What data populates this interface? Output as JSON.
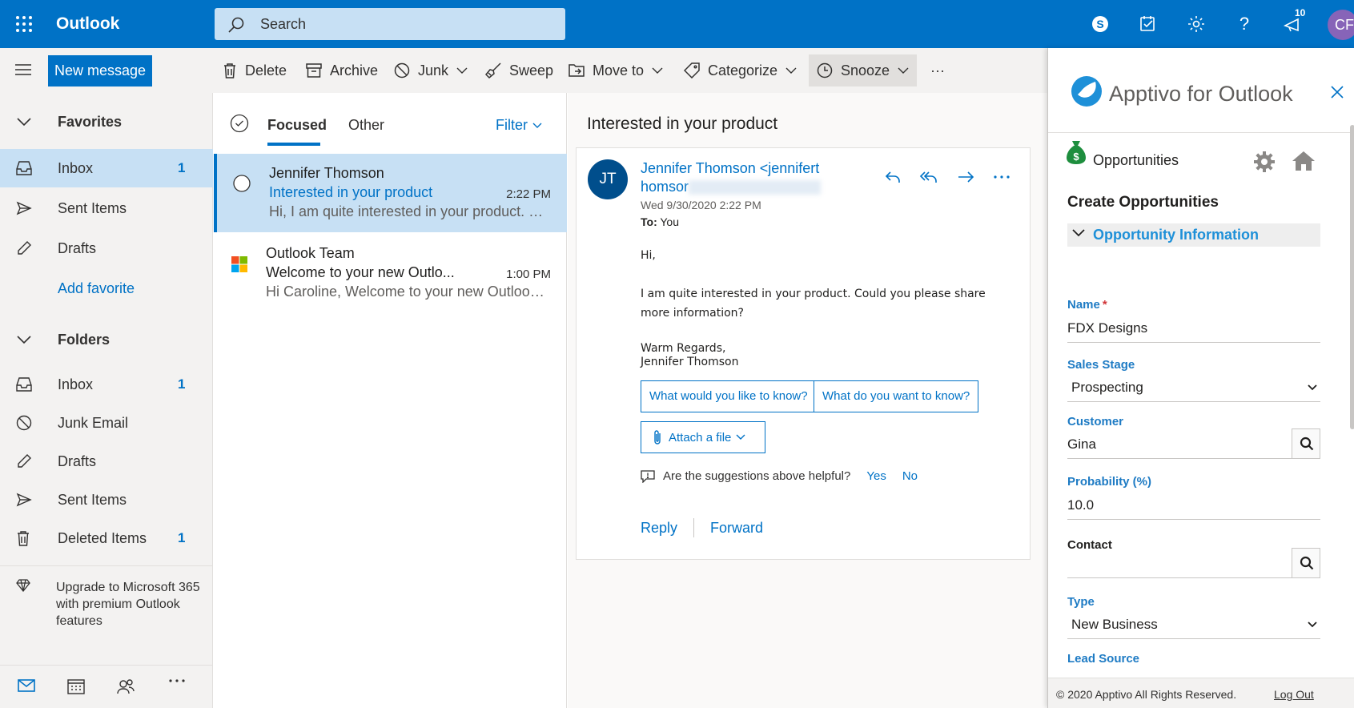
{
  "app": {
    "title": "Outlook"
  },
  "search": {
    "placeholder": "Search"
  },
  "topbar": {
    "notification_count": "10",
    "avatar_initials": "CF"
  },
  "toolbar": {
    "new_message": "New message",
    "delete": "Delete",
    "archive": "Archive",
    "junk": "Junk",
    "sweep": "Sweep",
    "move_to": "Move to",
    "categorize": "Categorize",
    "snooze": "Snooze",
    "more": "···"
  },
  "nav": {
    "favorites_header": "Favorites",
    "favorites": [
      {
        "label": "Inbox",
        "count": "1"
      },
      {
        "label": "Sent Items"
      },
      {
        "label": "Drafts"
      }
    ],
    "add_favorite": "Add favorite",
    "folders_header": "Folders",
    "folders": [
      {
        "label": "Inbox",
        "count": "1"
      },
      {
        "label": "Junk Email"
      },
      {
        "label": "Drafts"
      },
      {
        "label": "Sent Items"
      },
      {
        "label": "Deleted Items",
        "count": "1"
      }
    ],
    "upgrade_text": "Upgrade to Microsoft 365 with premium Outlook features"
  },
  "list": {
    "tab_focused": "Focused",
    "tab_other": "Other",
    "filter": "Filter",
    "messages": [
      {
        "from": "Jennifer Thomson",
        "subject": "Interested in your product",
        "time": "2:22 PM",
        "preview": "Hi, I am quite interested in your product. Could you please share more information?"
      },
      {
        "from": "Outlook Team",
        "subject": "Welcome to your new Outlo...",
        "time": "1:00 PM",
        "preview": "Hi Caroline, Welcome to your new Outlook.com account"
      }
    ]
  },
  "reading": {
    "title": "Interested in your product",
    "avatar": "JT",
    "sender_line1": "Jennifer Thomson <jennifert",
    "sender_line2": "homsor",
    "date": "Wed 9/30/2020 2:22 PM",
    "to_label": "To:",
    "to_value": "You",
    "greeting": "Hi,",
    "body": "I am quite interested in your product. Could you please share more information?",
    "regards": "Warm Regards,",
    "signature": "Jennifer Thomson",
    "suggestion_1": "What would you like to know?",
    "suggestion_2": "What do you want to know?",
    "attach": "Attach a file",
    "helpful_q": "Are the suggestions above helpful?",
    "yes": "Yes",
    "no": "No",
    "reply": "Reply",
    "forward": "Forward"
  },
  "apptivo": {
    "title": "Apptivo for Outlook",
    "module": "Opportunities",
    "create_title": "Create Opportunities",
    "section": "Opportunity Information",
    "fields": {
      "name_label": "Name",
      "name_value": "FDX Designs",
      "stage_label": "Sales Stage",
      "stage_value": "Prospecting",
      "customer_label": "Customer",
      "customer_value": "Gina",
      "probability_label": "Probability (%)",
      "probability_value": "10.0",
      "contact_label": "Contact",
      "contact_value": "",
      "type_label": "Type",
      "type_value": "New Business",
      "lead_source_label": "Lead Source"
    },
    "footer": "© 2020 Apptivo All Rights Reserved.",
    "logout": "Log Out"
  },
  "colors": {
    "brand_blue": "#0072c6",
    "selected_bg": "#c7e0f4",
    "apptivo_accent": "#1e90d8",
    "avatar_purple": "#8764b8"
  }
}
